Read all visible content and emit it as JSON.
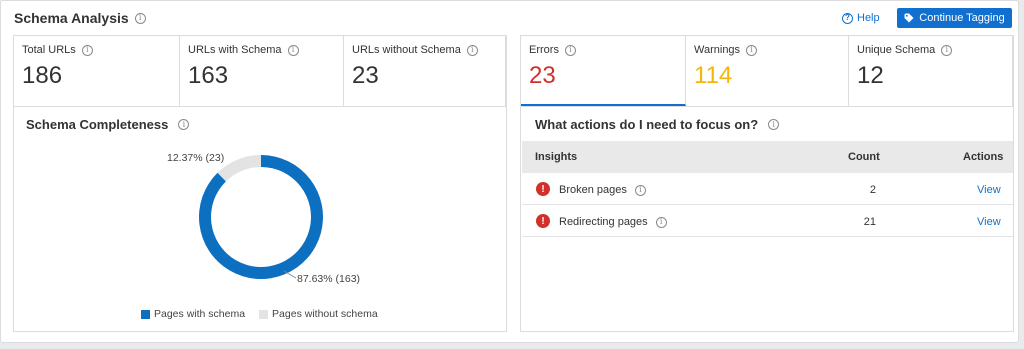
{
  "header": {
    "title": "Schema Analysis",
    "help_label": "Help",
    "continue_label": "Continue Tagging"
  },
  "metrics_left": [
    {
      "label": "Total URLs",
      "value": "186"
    },
    {
      "label": "URLs with Schema",
      "value": "163"
    },
    {
      "label": "URLs without Schema",
      "value": "23"
    }
  ],
  "metrics_right": [
    {
      "label": "Errors",
      "value": "23",
      "color": "#d0312d"
    },
    {
      "label": "Warnings",
      "value": "114",
      "color": "#f2b60c"
    },
    {
      "label": "Unique Schema",
      "value": "12",
      "color": "#333333"
    }
  ],
  "completeness": {
    "title": "Schema Completeness",
    "label_without": "12.37% (23)",
    "label_with": "87.63% (163)",
    "legend_with": "Pages with schema",
    "legend_without": "Pages without schema"
  },
  "chart_data": {
    "type": "pie",
    "title": "Schema Completeness",
    "categories": [
      "Pages with schema",
      "Pages without schema"
    ],
    "values": [
      163,
      23
    ],
    "percents": [
      87.63,
      12.37
    ],
    "colors": [
      "#0d6fbf",
      "#e3e3e3"
    ],
    "legend_position": "bottom"
  },
  "actions": {
    "title": "What actions do I need to focus on?",
    "columns": {
      "insights": "Insights",
      "count": "Count",
      "actions": "Actions"
    },
    "rows": [
      {
        "label": "Broken pages",
        "count": "2",
        "action": "View"
      },
      {
        "label": "Redirecting pages",
        "count": "21",
        "action": "View"
      }
    ]
  },
  "colors": {
    "accent": "#1170cf",
    "error": "#d0312d",
    "warning": "#f2b60c"
  }
}
